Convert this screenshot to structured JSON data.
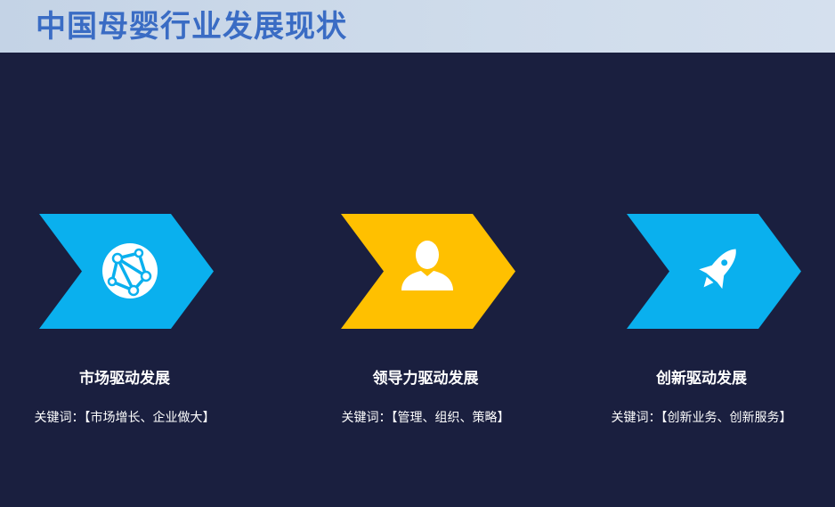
{
  "header": {
    "title": "中国母婴行业发展现状",
    "title_color": "#3a6cc4"
  },
  "cards": [
    {
      "title": "市场驱动发展",
      "keywords": "关键词：【市场增长、企业做大】",
      "icon": "globe-network-icon",
      "color": "#0ab0ee"
    },
    {
      "title": "领导力驱动发展",
      "keywords": "关键词：【管理、组织、策略】",
      "icon": "person-icon",
      "color": "#ffc000"
    },
    {
      "title": "创新驱动发展",
      "keywords": "关键词：【创新业务、创新服务】",
      "icon": "rocket-icon",
      "color": "#0ab0ee"
    }
  ]
}
